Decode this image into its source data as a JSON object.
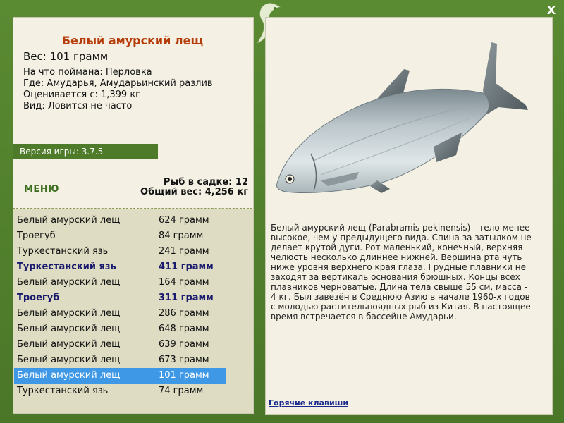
{
  "fish": {
    "title": "Белый амурский лещ",
    "weight": "Вес: 101 грамм",
    "caught_on": "На что поймана: Перловка",
    "location": "Где: Амударья, Амударьинский разлив",
    "valued": "Оценивается с: 1,399 кг",
    "kind": "Вид: Ловится не часто"
  },
  "version": "Версия игры: 3.7.5",
  "menu_label": "МЕНЮ",
  "stats": {
    "count": "Рыб в садке: 12",
    "total": "Общий вес: 4,256 кг"
  },
  "catch": [
    {
      "name": "Белый амурский лещ",
      "weight": "624 грамм",
      "style": "normal"
    },
    {
      "name": "Троегуб",
      "weight": "84 грамм",
      "style": "normal"
    },
    {
      "name": "Туркестанский язь",
      "weight": "241 грамм",
      "style": "normal"
    },
    {
      "name": "Туркестанский язь",
      "weight": "411 грамм",
      "style": "bold"
    },
    {
      "name": "Белый амурский лещ",
      "weight": "164 грамм",
      "style": "normal"
    },
    {
      "name": "Троегуб",
      "weight": "311 грамм",
      "style": "bold"
    },
    {
      "name": "Белый амурский лещ",
      "weight": "286 грамм",
      "style": "normal"
    },
    {
      "name": "Белый амурский лещ",
      "weight": "648 грамм",
      "style": "normal"
    },
    {
      "name": "Белый амурский лещ",
      "weight": "639 грамм",
      "style": "normal"
    },
    {
      "name": "Белый амурский лещ",
      "weight": "673 грамм",
      "style": "normal"
    },
    {
      "name": "Белый амурский лещ",
      "weight": "101 грамм",
      "style": "selected"
    },
    {
      "name": "Туркестанский язь",
      "weight": "74 грамм",
      "style": "normal"
    }
  ],
  "description": "Белый амурский лещ (Parabramis pekinensis) - тело менее высокое, чем у предыдущего вида. Спина за затылком не делает крутой дуги. Рот маленький, конечный, верхняя челюсть несколько длиннее нижней. Вершина рта чуть ниже уровня верхнего края глаза. Грудные плавники не заходят за вертикаль основания брюшных. Концы всех плавников черноватые. Длина тела свыше 55 см, масса - 4 кг. Был завезён в Среднюю Азию в начале 1960-х годов с молодью растительноядных рыб из Китая. В настоящее время встречается в бассейне Амударьи.",
  "hotkeys_label": "Горячие клавиши",
  "close_label": "X",
  "icons": {
    "close": "close-icon",
    "logo": "fish-logo-icon",
    "fish": "bream-fish-illustration"
  },
  "colors": {
    "frame": "#4d7a2c",
    "title": "#b63c0a",
    "selected": "#3f98e6",
    "bold_row": "#1a1a6e",
    "link": "#1a2a8c"
  }
}
